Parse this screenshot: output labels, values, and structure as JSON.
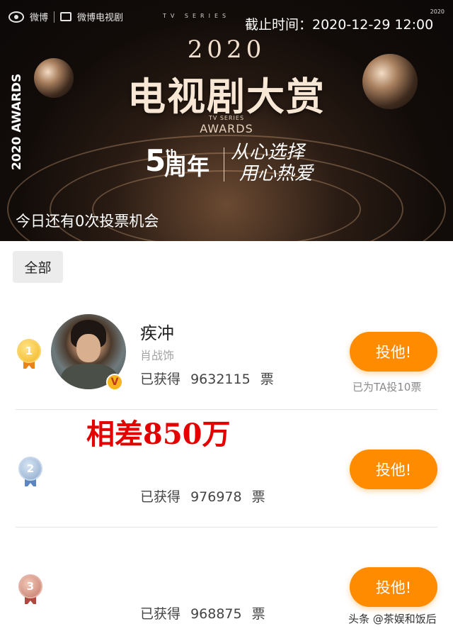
{
  "banner": {
    "logo_weibo": "微博",
    "logo_tv": "微博电视剧",
    "tv_series_top": "TV SERIES",
    "deadline": "截止时间：2020-12-29 12:00",
    "corner_badge": "2020",
    "vertical_award": "2020 AWARDS",
    "year": "2020",
    "title": "电视剧大赏",
    "tv_series": "TV SERIES",
    "awards": "AWARDS",
    "anniversary_number": "5",
    "anniversary_suffix": "th",
    "anniversary_word": "周年",
    "slogan_line1": "从心选择",
    "slogan_line2": "用心热爱",
    "votes_today": "今日还有0次投票机会"
  },
  "filter": {
    "label": "全部"
  },
  "rows": [
    {
      "rank": "1",
      "name": "疾冲",
      "role": "肖战饰",
      "count_label": "已获得",
      "count": "9632115",
      "unit": "票",
      "vote_button": "投他!",
      "voted_note": "已为TA投10票",
      "badge": "V"
    },
    {
      "rank": "2",
      "count_label": "已获得",
      "count": "976978",
      "unit": "票",
      "vote_button": "投他!"
    },
    {
      "rank": "3",
      "count_label": "已获得",
      "count": "968875",
      "unit": "票",
      "vote_button": "投他!"
    }
  ],
  "annotation": {
    "difference": "相差850万"
  },
  "watermark": "头条 @茶娱和饭后",
  "colors": {
    "accent": "#ff8c00",
    "annotation": "#e40000"
  }
}
